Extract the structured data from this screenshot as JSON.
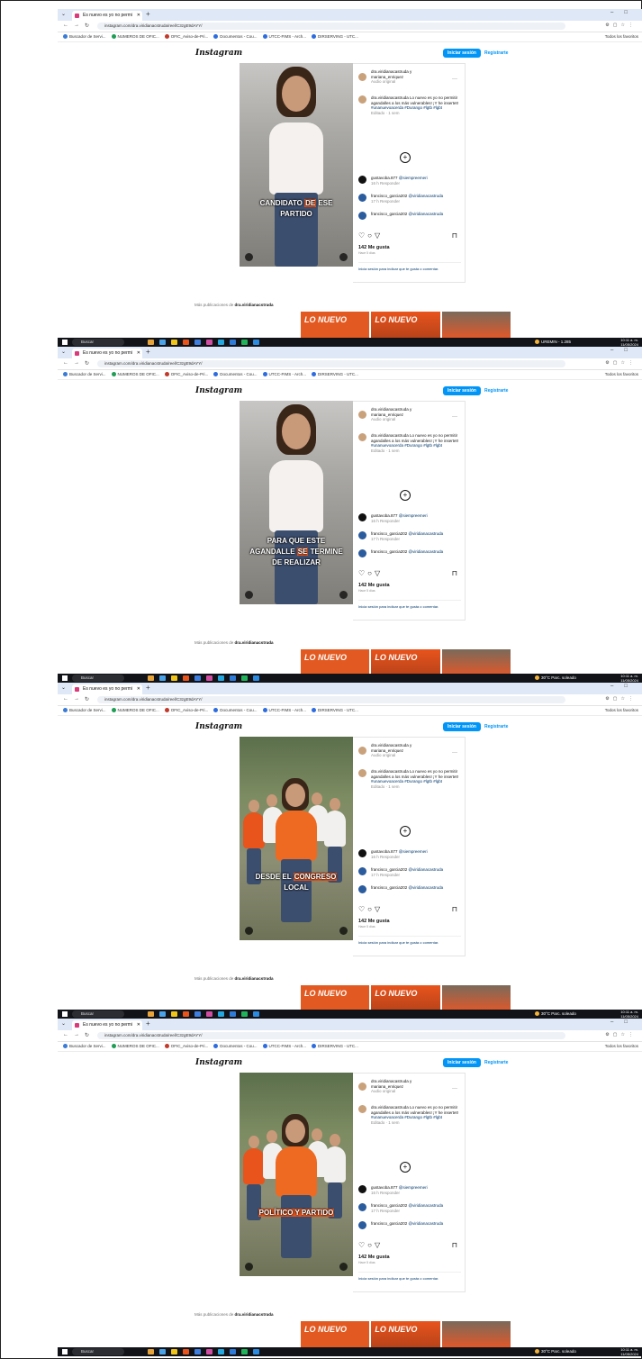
{
  "browser": {
    "tab_title": "Es nuevo es yo no permi",
    "url": "instagram.com/dra.viridianacstruda/reel/C3zgE9dAYY/",
    "bookmarks": [
      "Buscador de Servi...",
      "NUMEROS DE OFIC...",
      "OFIC_Aviso-de-Pri...",
      "Documentos - Cou...",
      "UTCC-FIMS - Arch...",
      "DIRSERVING - UTC..."
    ],
    "all_bookmarks": "Todos los favoritos"
  },
  "instagram": {
    "logo": "Instagram",
    "login_button": "Iniciar sesión",
    "register_link": "Registrarte",
    "header_user_line1": "dra.viridianacastruda y",
    "header_user_line2": "mariana_enriquez",
    "header_audio": "Audio original",
    "caption_user": "dra.viridianacastruda",
    "caption_text": "Lo nuevo es yo no permitir agandalles a los más vulnerables! ¡Y he insertet!",
    "caption_tags": "#unanuevoacerda #Durango #lgtb #lgbt",
    "caption_time": "Editado · 1 sem",
    "comments": [
      {
        "user": "gustavoba.877",
        "text": "@siempreemeri",
        "meta": "16 h  Responder"
      },
      {
        "user": "francisco_garcia202",
        "text": "@viridianacastruda",
        "meta": "17 h  Responder"
      },
      {
        "user": "francisco_garcia202",
        "text": "@viridianacastruda",
        "meta": ""
      }
    ],
    "likes": "142 Me gusta",
    "date": "Hace 5 días",
    "login_note": "Inicia sesión para indicar que te gusta o comentar.",
    "more_posts_prefix": "Más publicaciones de",
    "more_posts_user": "dra.viridianacstruda",
    "thumb_text": "LO NUEVO"
  },
  "frames": [
    {
      "caption_pre": "CANDIDATO ",
      "caption_hl": "DE",
      "caption_post": " ESE PARTIDO",
      "scene": "talk"
    },
    {
      "caption_pre": "PARA QUE ESTE AGANDALLE ",
      "caption_hl": "SE",
      "caption_post": " TERMINE DE REALIZAR",
      "scene": "talk"
    },
    {
      "caption_pre": "DESDE EL ",
      "caption_hl": "CONGRESO",
      "caption_post": " LOCAL",
      "scene": "outdoor"
    },
    {
      "caption_pre": "",
      "caption_hl": "POLÍTICO Y PARTIDO",
      "caption_post": "",
      "scene": "outdoor"
    }
  ],
  "taskbar": {
    "search": "Buscar",
    "weather_first": "UREMIN - 1.285",
    "weather": "30°C  Parc. soleado",
    "clock_time": "10:11 a. m.",
    "clock_date": "11/05/2024"
  },
  "colors": {
    "accent_instagram": "#0095f6",
    "brand_orange": "#e8541c"
  }
}
